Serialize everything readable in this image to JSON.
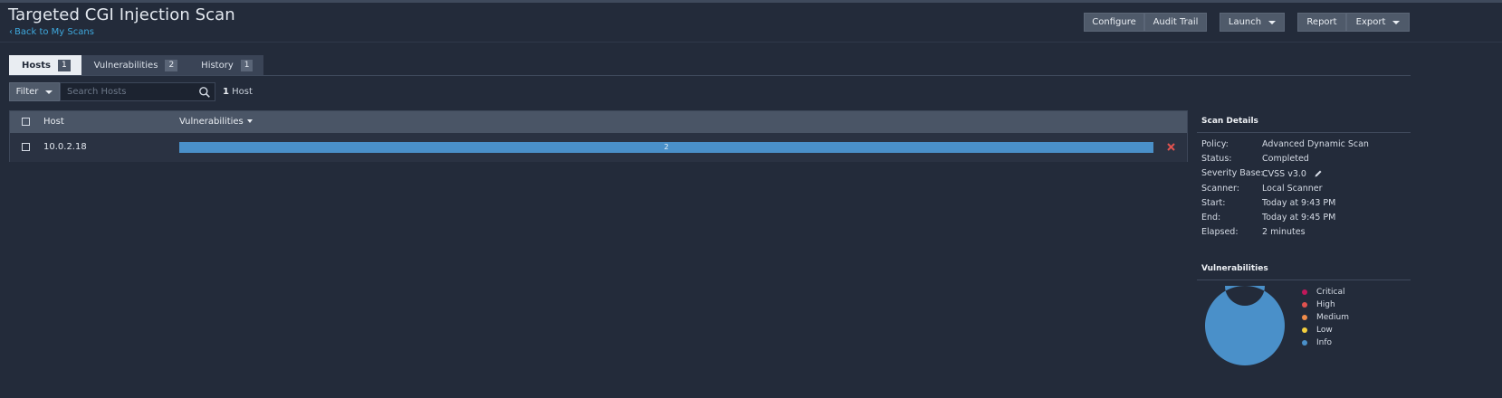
{
  "page": {
    "title": "Targeted CGI Injection Scan",
    "back_link": "Back to My Scans"
  },
  "toolbar": {
    "configure": "Configure",
    "audit_trail": "Audit Trail",
    "launch": "Launch",
    "report": "Report",
    "export": "Export"
  },
  "tabs": [
    {
      "label": "Hosts",
      "count": "1",
      "active": true
    },
    {
      "label": "Vulnerabilities",
      "count": "2",
      "active": false
    },
    {
      "label": "History",
      "count": "1",
      "active": false
    }
  ],
  "filter": {
    "label": "Filter",
    "search_placeholder": "Search Hosts",
    "host_count_number": "1",
    "host_count_label": "Host"
  },
  "table": {
    "columns": {
      "host": "Host",
      "vulnerabilities": "Vulnerabilities"
    },
    "rows": [
      {
        "host": "10.0.2.18",
        "vuln_count": "2",
        "info_fraction": 1.0
      }
    ]
  },
  "scan_details": {
    "title": "Scan Details",
    "policy_label": "Policy:",
    "policy": "Advanced Dynamic Scan",
    "status_label": "Status:",
    "status": "Completed",
    "severity_label": "Severity Base:",
    "severity": "CVSS v3.0",
    "scanner_label": "Scanner:",
    "scanner": "Local Scanner",
    "start_label": "Start:",
    "start": "Today at 9:43 PM",
    "end_label": "End:",
    "end": "Today at 9:45 PM",
    "elapsed_label": "Elapsed:",
    "elapsed": "2 minutes"
  },
  "vulnerabilities_chart": {
    "title": "Vulnerabilities",
    "legend": [
      {
        "label": "Critical",
        "color": "#c0185a"
      },
      {
        "label": "High",
        "color": "#e0524f"
      },
      {
        "label": "Medium",
        "color": "#f08c4a"
      },
      {
        "label": "Low",
        "color": "#f4cf3e"
      },
      {
        "label": "Info",
        "color": "#4a90c9"
      }
    ]
  },
  "chart_data": {
    "type": "pie",
    "categories": [
      "Critical",
      "High",
      "Medium",
      "Low",
      "Info"
    ],
    "values": [
      0,
      0,
      0,
      0,
      2
    ],
    "title": "Vulnerabilities"
  },
  "icons": {
    "search": "search-icon",
    "remove": "close-icon",
    "edit": "pencil-icon",
    "back": "chevron-left-icon"
  },
  "colors": {
    "background": "#232b3a",
    "accent_link": "#3ea8dd",
    "info": "#4a90c9",
    "remove": "#e0524f"
  }
}
